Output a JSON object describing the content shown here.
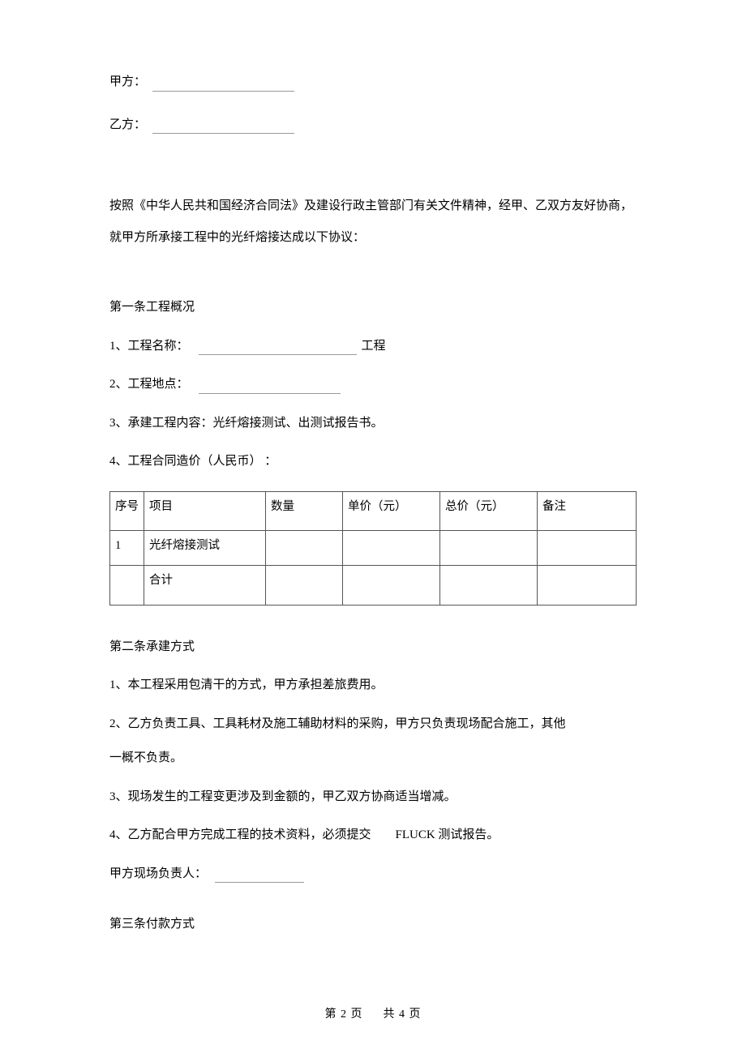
{
  "parties": {
    "a_label": "甲方：",
    "b_label": "乙方："
  },
  "intro": "按照《中华人民共和国经济合同法》及建设行政主管部门有关文件精神，经甲、乙双方友好协商，就甲方所承接工程中的光纤熔接达成以下协议：",
  "section1": {
    "title": "第一条工程概况",
    "item1_pre": "1、工程名称：",
    "item1_suf": "工程",
    "item2": "2、工程地点：",
    "item3": "3、承建工程内容：光纤熔接测试、出测试报告书。",
    "item4": "4、工程合同造价（人民币） ：",
    "table": {
      "headers": [
        "序号",
        "项目",
        "数量",
        "单价（元）",
        "总价（元）",
        "备注"
      ],
      "rows": [
        {
          "no": "1",
          "name": "光纤熔接测试",
          "qty": "",
          "unit": "",
          "total": "",
          "note": ""
        },
        {
          "no": "",
          "name": "合计",
          "qty": "",
          "unit": "",
          "total": "",
          "note": ""
        }
      ]
    }
  },
  "section2": {
    "title": "第二条承建方式",
    "item1": "1、本工程采用包清干的方式，甲方承担差旅费用。",
    "item2a": "2、乙方负责工具、工具耗材及施工辅助材料的采购，甲方只负责现场配合施工，其他",
    "item2b": "一概不负责。",
    "item3": "3、现场发生的工程变更涉及到金额的，甲乙双方协商适当增减。",
    "item4": "4、乙方配合甲方完成工程的技术资料，必须提交　　FLUCK 测试报告。",
    "lead": "甲方现场负责人："
  },
  "section3": {
    "title": "第三条付款方式"
  },
  "footer": {
    "left": "第 2  页",
    "right": "共 4  页"
  }
}
